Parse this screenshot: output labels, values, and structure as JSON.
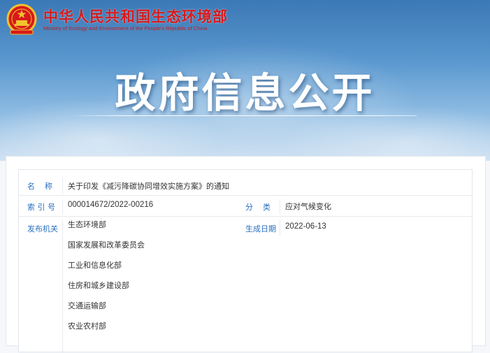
{
  "header": {
    "ministry_name_cn": "中华人民共和国生态环境部",
    "ministry_name_en": "Ministry of Ecology and Environment of the People's Republic of China",
    "page_title": "政府信息公开"
  },
  "colors": {
    "brand_red": "#d71a1b",
    "label_blue": "#2a6fc1",
    "sky_blue": "#3b78b6"
  },
  "icons": {
    "emblem": "national-emblem-icon"
  },
  "info": {
    "name_label": "名    称",
    "name_value": "关于印发《减污降碳协同增效实施方案》的通知",
    "index_label": "索 引 号",
    "index_value": "000014672/2022-00216",
    "category_label": "分    类",
    "category_value": "应对气候变化",
    "issuer_label": "发布机关",
    "date_label": "生成日期",
    "date_value": "2022-06-13",
    "issuers": [
      "生态环境部",
      "国家发展和改革委员会",
      "工业和信息化部",
      "住房和城乡建设部",
      "交通运输部",
      "农业农村部"
    ]
  }
}
